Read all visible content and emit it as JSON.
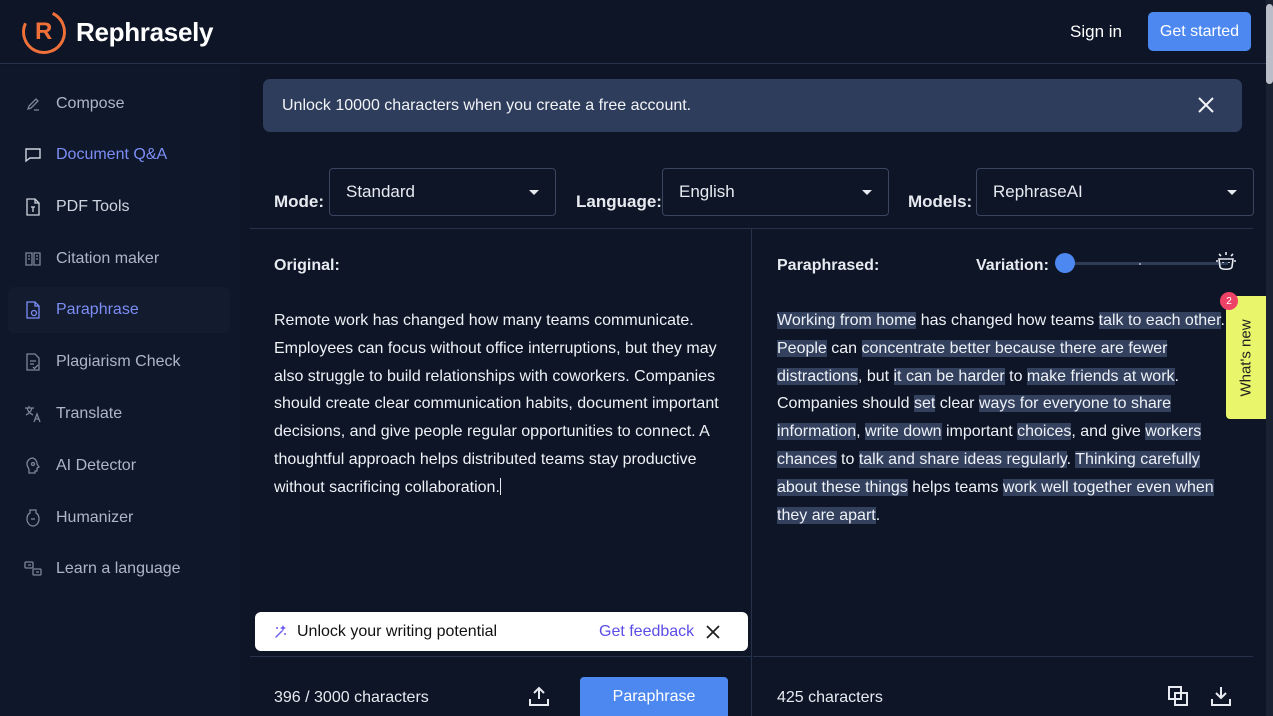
{
  "header": {
    "logo_letter": "R",
    "brand": "Rephrasely",
    "sign_in": "Sign in",
    "get_started": "Get started"
  },
  "sidebar": {
    "items": [
      {
        "label": "Compose",
        "icon": "pen-icon"
      },
      {
        "label": "Document Q&A",
        "icon": "chat-icon"
      },
      {
        "label": "PDF Tools",
        "icon": "pdf-icon"
      },
      {
        "label": "Citation maker",
        "icon": "book-icon"
      },
      {
        "label": "Paraphrase",
        "icon": "document-icon",
        "active": true
      },
      {
        "label": "Plagiarism Check",
        "icon": "check-document-icon"
      },
      {
        "label": "Translate",
        "icon": "translate-icon"
      },
      {
        "label": "AI Detector",
        "icon": "ai-detector-icon"
      },
      {
        "label": "Humanizer",
        "icon": "humanizer-icon"
      },
      {
        "label": "Learn a language",
        "icon": "language-icon"
      }
    ]
  },
  "banner": {
    "text": "Unlock 10000 characters when you create a free account."
  },
  "toolbar": {
    "mode_label": "Mode:",
    "mode_value": "Standard",
    "language_label": "Language:",
    "language_value": "English",
    "models_label": "Models:",
    "models_value": "RephraseAI"
  },
  "original": {
    "title": "Original:",
    "text": "Remote work has changed how many teams communicate. Employees can focus without office interruptions, but they may also struggle to build relationships with coworkers. Companies should create clear communication habits, document important decisions, and give people regular opportunities to connect. A thoughtful approach helps distributed teams stay productive without sacrificing collaboration.",
    "char_count": "396 / 3000 characters",
    "paraphrase_button": "Paraphrase"
  },
  "paraphrased": {
    "title": "Paraphrased:",
    "variation_label": "Variation:",
    "variation_level": 0,
    "segments": [
      {
        "t": "Working from home",
        "h": true
      },
      {
        "t": " has changed how teams ",
        "h": false
      },
      {
        "t": "talk to each other",
        "h": true
      },
      {
        "t": ". ",
        "h": false
      },
      {
        "t": "People",
        "h": true
      },
      {
        "t": " can ",
        "h": false
      },
      {
        "t": "concentrate better because there are fewer distractions",
        "h": true
      },
      {
        "t": ", but ",
        "h": false
      },
      {
        "t": "it can be harder",
        "h": true
      },
      {
        "t": " to ",
        "h": false
      },
      {
        "t": "make friends at work",
        "h": true
      },
      {
        "t": ". Companies should ",
        "h": false
      },
      {
        "t": "set",
        "h": true
      },
      {
        "t": " clear ",
        "h": false
      },
      {
        "t": "ways for everyone to share information",
        "h": true
      },
      {
        "t": ", ",
        "h": false
      },
      {
        "t": "write down",
        "h": true
      },
      {
        "t": " important ",
        "h": false
      },
      {
        "t": "choices",
        "h": true
      },
      {
        "t": ", and give ",
        "h": false
      },
      {
        "t": "workers chances",
        "h": true
      },
      {
        "t": " to ",
        "h": false
      },
      {
        "t": "talk and share ideas regularly",
        "h": true
      },
      {
        "t": ". ",
        "h": false
      },
      {
        "t": "Thinking carefully about these things",
        "h": true
      },
      {
        "t": " helps teams ",
        "h": false
      },
      {
        "t": "work well together even when they are apart",
        "h": true
      },
      {
        "t": ".",
        "h": false
      }
    ],
    "char_count": "425 characters"
  },
  "toast": {
    "text": "Unlock your writing potential",
    "link": "Get feedback"
  },
  "whats_new": {
    "label": "What's new",
    "badge": "2"
  },
  "colors": {
    "accent": "#4d87f0",
    "active_nav": "#7c8ef6",
    "background": "#0d1526",
    "highlight": "#33415e",
    "whats_new_bg": "#e9f56b",
    "logo": "#f0703a"
  }
}
